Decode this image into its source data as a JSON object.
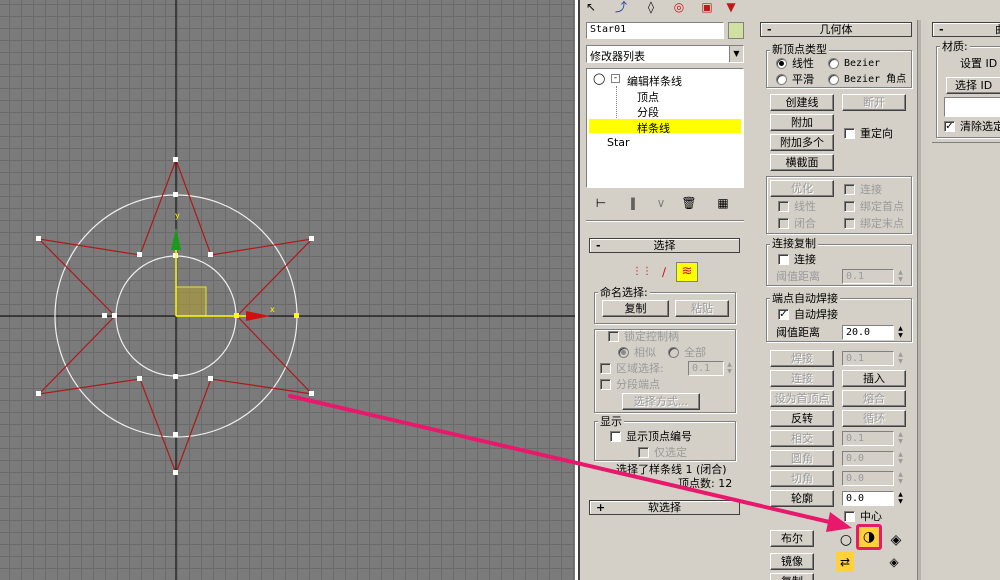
{
  "viewport": {
    "axis_x_label": "x",
    "axis_y_label": "y"
  },
  "object_name": "Star01",
  "modifier_list_label": "修改器列表",
  "stack": {
    "items": [
      {
        "label": "编辑样条线"
      },
      {
        "label": "顶点"
      },
      {
        "label": "分段"
      },
      {
        "label": "样条线"
      },
      {
        "label": "Star"
      }
    ]
  },
  "selection_rollout": {
    "title": "选择",
    "named_selection_label": "命名选择:",
    "copy_label": "复制",
    "paste_label": "粘贴",
    "lock_handles_label": "锁定控制柄",
    "alike_label": "相似",
    "all_label": "全部",
    "area_select_label": "区域选择:",
    "area_select_value": "0.1",
    "segment_end_label": "分段端点",
    "select_by_label": "选择方式...",
    "display_label": "显示",
    "show_vertex_numbers_label": "显示顶点编号",
    "selected_only_label": "仅选定",
    "status_line1": "选择了样条线 1 (闭合)",
    "status_line2": "顶点数: 12"
  },
  "soft_select_rollout": {
    "title": "软选择"
  },
  "geometry_rollout": {
    "title": "几何体",
    "new_vertex_type_label": "新顶点类型",
    "linear_label": "线性",
    "bezier_label": "Bezier",
    "smooth_label": "平滑",
    "bezier_corner_label": "Bezier 角点",
    "create_line_label": "创建线",
    "break_label": "断开",
    "attach_label": "附加",
    "attach_mult_label": "附加多个",
    "reorient_label": "重定向",
    "cross_section_label": "横截面",
    "refine_label": "优化",
    "connect_label": "连接",
    "linear2_label": "线性",
    "bind_first_label": "绑定首点",
    "closed_label": "闭合",
    "bind_last_label": "绑定末点",
    "connect_copy_label": "连接复制",
    "connect_chk_label": "连接",
    "threshold_label": "阈值距离",
    "threshold_value": "0.1",
    "end_weld_label": "端点自动焊接",
    "auto_weld_label": "自动焊接",
    "auto_threshold_label": "阈值距离",
    "auto_threshold_value": "20.0",
    "weld_label": "焊接",
    "weld_value": "0.1",
    "connect_btn_label": "连接",
    "insert_label": "插入",
    "make_first_label": "设为首顶点",
    "fuse_label": "熔合",
    "reverse_label": "反转",
    "cycle_label": "循环",
    "cross_insert_label": "相交",
    "cross_insert_value": "0.1",
    "fillet_label": "圆角",
    "fillet_value": "0.0",
    "chamfer_label": "切角",
    "chamfer_value": "0.0",
    "outline_label": "轮廓",
    "outline_value": "0.0",
    "center_label": "中心",
    "boolean_label": "布尔",
    "mirror_label": "镜像",
    "copy_label": "复制"
  },
  "surface_rollout": {
    "title": "曲",
    "material_label": "材质:",
    "set_id_label": "设置 ID",
    "select_id_label": "选择 ID",
    "clear_sel_label": "清除选定"
  },
  "colors": {
    "viewport_bg": "#7b7b7b",
    "highlight_yellow": "#ffff00",
    "arrow_magenta": "#e8196c",
    "spline_red": "#b01818"
  },
  "icons": {
    "toolbar": [
      "select-arrow-icon",
      "bend-icon",
      "hierarchy-icon",
      "motion-icon",
      "display-icon",
      "utilities-icon"
    ],
    "stack_tools": [
      "pin-icon",
      "show-end-icon",
      "make-unique-icon",
      "remove-modifier-icon",
      "configure-icon"
    ],
    "selection_modes": [
      "vertex-mode-icon",
      "segment-mode-icon",
      "spline-mode-icon"
    ],
    "boolean_ops": [
      "union-icon",
      "subtract-icon",
      "intersect-icon"
    ]
  }
}
